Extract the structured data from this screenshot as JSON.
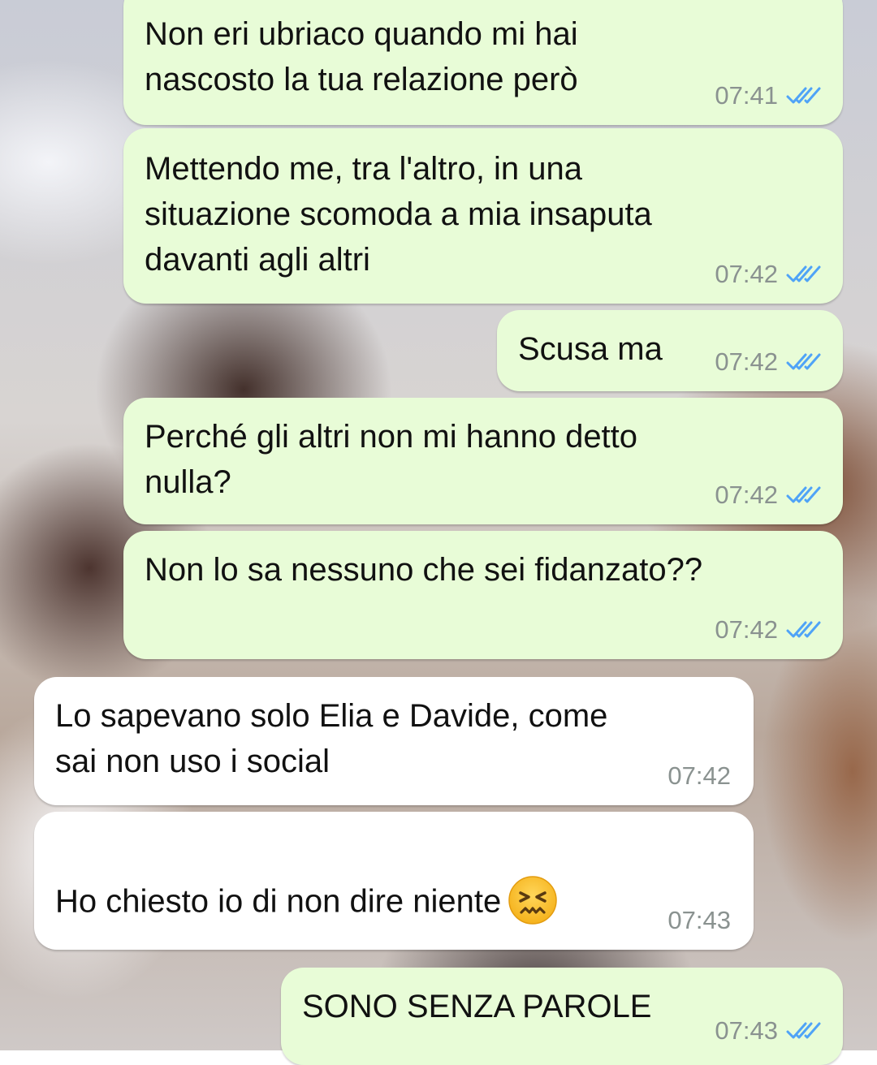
{
  "messages": [
    {
      "direction": "outgoing",
      "text": "Non eri ubriaco quando mi hai\nnascosto la tua relazione però",
      "time": "07:41",
      "read": true
    },
    {
      "direction": "outgoing",
      "text": "Mettendo me, tra l'altro, in una\nsituazione scomoda a mia insaputa\ndavanti agli altri",
      "time": "07:42",
      "read": true
    },
    {
      "direction": "outgoing",
      "text": "Scusa ma",
      "time": "07:42",
      "read": true
    },
    {
      "direction": "outgoing",
      "text": "Perché gli altri non mi hanno detto\nnulla?",
      "time": "07:42",
      "read": true
    },
    {
      "direction": "outgoing",
      "text": "Non lo sa nessuno che sei fidanzato??",
      "time": "07:42",
      "read": true
    },
    {
      "direction": "incoming",
      "text": "Lo sapevano solo Elia e Davide, come\nsai non uso i social",
      "time": "07:42"
    },
    {
      "direction": "incoming",
      "text": "Ho chiesto io di non dire niente",
      "emoji": "confounded-face",
      "time": "07:43"
    },
    {
      "direction": "outgoing",
      "text": "SONO SENZA PAROLE",
      "time": "07:43",
      "read": true
    }
  ],
  "colors": {
    "outgoing_bubble": "#e8fcd7",
    "incoming_bubble": "#ffffff",
    "timestamp": "#8a9290",
    "read_ticks": "#4fa3f7"
  },
  "icons": {
    "read_receipt": "double-check-icon",
    "emoji": "confounded-face-emoji"
  }
}
